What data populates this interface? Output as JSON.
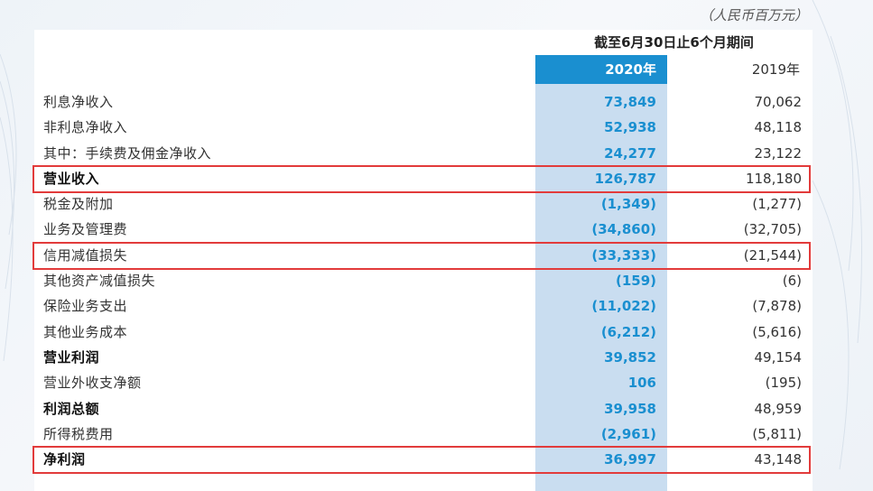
{
  "unit_note": "（人民币百万元）",
  "header": {
    "period": "截至6月30日止6个月期间",
    "year_current": "2020年",
    "year_prior": "2019年"
  },
  "rows": [
    {
      "label": "利息净收入",
      "v2020": "73,849",
      "v2019": "70,062",
      "bold": false
    },
    {
      "label": "非利息净收入",
      "v2020": "52,938",
      "v2019": "48,118",
      "bold": false
    },
    {
      "label": "其中：手续费及佣金净收入",
      "v2020": "24,277",
      "v2019": "23,122",
      "bold": false
    },
    {
      "label": "营业收入",
      "v2020": "126,787",
      "v2019": "118,180",
      "bold": true
    },
    {
      "label": "税金及附加",
      "v2020": "(1,349)",
      "v2019": "(1,277)",
      "bold": false
    },
    {
      "label": "业务及管理费",
      "v2020": "(34,860)",
      "v2019": "(32,705)",
      "bold": false
    },
    {
      "label": "信用减值损失",
      "v2020": "(33,333)",
      "v2019": "(21,544)",
      "bold": false
    },
    {
      "label": "其他资产减值损失",
      "v2020": "(159)",
      "v2019": "(6)",
      "bold": false
    },
    {
      "label": "保险业务支出",
      "v2020": "(11,022)",
      "v2019": "(7,878)",
      "bold": false
    },
    {
      "label": "其他业务成本",
      "v2020": "(6,212)",
      "v2019": "(5,616)",
      "bold": false
    },
    {
      "label": "营业利润",
      "v2020": "39,852",
      "v2019": "49,154",
      "bold": true
    },
    {
      "label": "营业外收支净额",
      "v2020": "106",
      "v2019": "(195)",
      "bold": false
    },
    {
      "label": "利润总额",
      "v2020": "39,958",
      "v2019": "48,959",
      "bold": true
    },
    {
      "label": "所得税费用",
      "v2020": "(2,961)",
      "v2019": "(5,811)",
      "bold": false
    },
    {
      "label": "净利润",
      "v2020": "36,997",
      "v2019": "43,148",
      "bold": true
    }
  ],
  "highlighted_rows": [
    3,
    6,
    14
  ],
  "colors": {
    "accent_blue": "#1a8fd0",
    "column_fill": "#c9ddf0",
    "highlight_red": "#e23b3b"
  }
}
